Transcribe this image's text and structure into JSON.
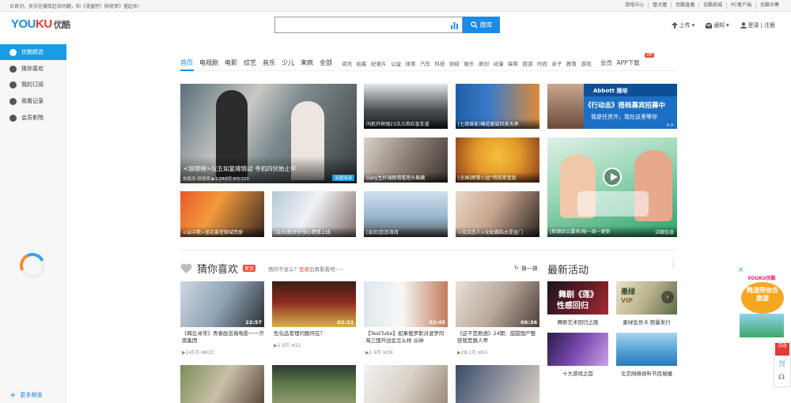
{
  "topbar": {
    "notice": "台首词，吴莎驻爆笑赶去同籍，和《漫童吧！肿癌哥》盛起来！",
    "links": [
      "游戏中心",
      "整点播",
      "优酷直播",
      "优酷商城",
      "PC客户端",
      "优酷众筹"
    ]
  },
  "header": {
    "logo_youku": "YOUKU",
    "logo_cn": "优酷",
    "search_placeholder": "",
    "search_button": "搜库",
    "upload": "上传",
    "notify": "通知",
    "login": "登录",
    "register": "注册"
  },
  "sidebar": {
    "items": [
      "优酷精选",
      "猜你喜欢",
      "我的订阅",
      "观看记录",
      "会员影院"
    ],
    "more": "更多频道"
  },
  "nav": {
    "main": [
      "首页",
      "电视剧",
      "电影",
      "综艺",
      "音乐",
      "少儿",
      "来疯",
      "全部"
    ],
    "sub": [
      "资讯",
      "拍客",
      "纪录片",
      "公益",
      "体育",
      "汽车",
      "科技",
      "财经",
      "娱乐",
      "原创",
      "动漫",
      "搞笑",
      "旅游",
      "时尚",
      "亲子",
      "教育",
      "游戏",
      "会员",
      "APP下载"
    ],
    "vip_badge": "VIP"
  },
  "hero": {
    "main_caption": "<琅琊榜>玩五如复嫁情动 寻机四伏始止年",
    "main_source": "故霸场·琅琊榜",
    "main_views": "1,243万",
    "main_comments": "3,115",
    "main_tag": "深度阅读",
    "tiles": [
      "问机开奔驰23次占用应急车道",
      "[七绝雄影]曝超暖疑回美天承",
      "Gary生扑强跑唱看抱头躲藏",
      "[全国]跨事小盆\"鸡肉宵宝饭",
      "<云中歌>蓝廷暴登穆城荒原",
      "[会员]新步步惊心嗯情上线",
      "[会员]恋恋海湾",
      "<克拉恋人>女配霸陷总是金门"
    ],
    "ad_brand": "Abbott 雅培",
    "ad_line1": "《行动志》搭档募宾招募中",
    "ad_line2": "我是任资齐，我在这里等你",
    "feature_caption": "[新娘妙吕要来]每一周一更新",
    "feature_tag": "详细信息"
  },
  "guess": {
    "title": "猜你喜欢",
    "badge": "首页",
    "prompt": "猜的不准么？",
    "prompt_link": "登录",
    "prompt_rest": "后再看看吧~~",
    "refresh": "换一换",
    "videos": [
      {
        "title": "《辉比寻常》青春励志微电影一一齐跑集团",
        "duration": "22:57",
        "views": "145万",
        "comments": "633"
      },
      {
        "title": "危化品管理问题何在？",
        "duration": "02:32",
        "views": "2.9万",
        "comments": "21"
      },
      {
        "title": "【TestTube】如果俄罗斯对波罗的海三国开战会怎么样 @钟",
        "duration": "02:45",
        "views": "1.9万",
        "comments": "39"
      },
      {
        "title": "《这不是剧透》24期：甜甜国产整容我是路人甲",
        "duration": "06:36",
        "views": "28.1万",
        "comments": "55"
      }
    ]
  },
  "activities": {
    "title": "最新活动",
    "items": [
      "舞剧艺术回归之路",
      "墨绿会员卡 限量发行",
      "十大游戏之首",
      "北京网络视听节目展播"
    ],
    "tile_text": [
      "舞剧《莲》",
      "性感回归",
      "墨绿",
      "VIP"
    ]
  },
  "float_ad": {
    "brand": "YOUKU优酷",
    "text": "韩流带你去旅游"
  },
  "tools": {
    "label": "活动"
  }
}
